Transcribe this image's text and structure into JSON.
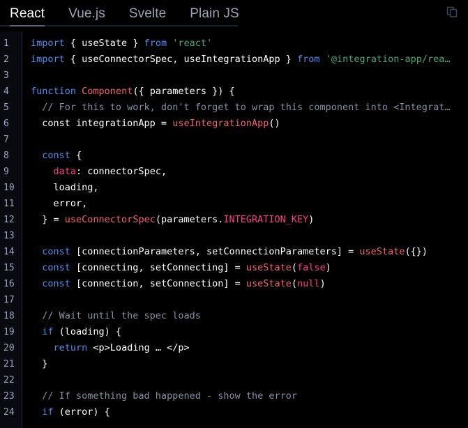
{
  "header": {
    "tabs": [
      {
        "label": "React",
        "active": true
      },
      {
        "label": "Vue.js",
        "active": false
      },
      {
        "label": "Svelte",
        "active": false
      },
      {
        "label": "Plain JS",
        "active": false
      }
    ],
    "copy_button": {
      "icon": "copy-icon",
      "title": "Copy"
    }
  },
  "editor": {
    "language": "jsx",
    "line_numbers": [
      "1",
      "2",
      "3",
      "4",
      "5",
      "6",
      "7",
      "8",
      "9",
      "10",
      "11",
      "12",
      "13",
      "14",
      "15",
      "16",
      "17",
      "18",
      "19",
      "20",
      "21",
      "22",
      "23",
      "24"
    ],
    "lines": [
      {
        "n": 1,
        "tokens": [
          {
            "t": "import",
            "c": "key"
          },
          {
            "t": " { useState } ",
            "c": "plain"
          },
          {
            "t": "from",
            "c": "key"
          },
          {
            "t": " ",
            "c": "plain"
          },
          {
            "t": "'react'",
            "c": "str"
          }
        ]
      },
      {
        "n": 2,
        "tokens": [
          {
            "t": "import",
            "c": "key"
          },
          {
            "t": " { useConnectorSpec, useIntegrationApp } ",
            "c": "plain"
          },
          {
            "t": "from",
            "c": "key"
          },
          {
            "t": " ",
            "c": "plain"
          },
          {
            "t": "'@integration-app/rea…",
            "c": "str"
          }
        ]
      },
      {
        "n": 3,
        "tokens": []
      },
      {
        "n": 4,
        "tokens": [
          {
            "t": "function",
            "c": "key"
          },
          {
            "t": " ",
            "c": "plain"
          },
          {
            "t": "Component",
            "c": "fn"
          },
          {
            "t": "({ parameters }) {",
            "c": "plain"
          }
        ]
      },
      {
        "n": 5,
        "tokens": [
          {
            "t": "  // For this to work, don't forget to wrap this component into <Integrat…",
            "c": "cmt"
          }
        ]
      },
      {
        "n": 6,
        "tokens": [
          {
            "t": "  const integrationApp = ",
            "c": "plain"
          },
          {
            "t": "useIntegrationApp",
            "c": "fn"
          },
          {
            "t": "()",
            "c": "plain"
          }
        ]
      },
      {
        "n": 7,
        "tokens": []
      },
      {
        "n": 8,
        "tokens": [
          {
            "t": "  ",
            "c": "plain"
          },
          {
            "t": "const",
            "c": "key"
          },
          {
            "t": " {",
            "c": "plain"
          }
        ]
      },
      {
        "n": 9,
        "tokens": [
          {
            "t": "    ",
            "c": "plain"
          },
          {
            "t": "data",
            "c": "const"
          },
          {
            "t": ": connectorSpec,",
            "c": "plain"
          }
        ]
      },
      {
        "n": 10,
        "tokens": [
          {
            "t": "    loading,",
            "c": "plain"
          }
        ]
      },
      {
        "n": 11,
        "tokens": [
          {
            "t": "    error,",
            "c": "plain"
          }
        ]
      },
      {
        "n": 12,
        "tokens": [
          {
            "t": "  } = ",
            "c": "plain"
          },
          {
            "t": "useConnectorSpec",
            "c": "fn"
          },
          {
            "t": "(parameters.",
            "c": "plain"
          },
          {
            "t": "INTEGRATION_KEY",
            "c": "const"
          },
          {
            "t": ")",
            "c": "plain"
          }
        ]
      },
      {
        "n": 13,
        "tokens": []
      },
      {
        "n": 14,
        "tokens": [
          {
            "t": "  ",
            "c": "plain"
          },
          {
            "t": "const",
            "c": "key"
          },
          {
            "t": " [connectionParameters, setConnectionParameters] = ",
            "c": "plain"
          },
          {
            "t": "useState",
            "c": "fn"
          },
          {
            "t": "({})",
            "c": "plain"
          }
        ]
      },
      {
        "n": 15,
        "tokens": [
          {
            "t": "  ",
            "c": "plain"
          },
          {
            "t": "const",
            "c": "key"
          },
          {
            "t": " [connecting, setConnecting] = ",
            "c": "plain"
          },
          {
            "t": "useState",
            "c": "fn"
          },
          {
            "t": "(",
            "c": "plain"
          },
          {
            "t": "false",
            "c": "const"
          },
          {
            "t": ")",
            "c": "plain"
          }
        ]
      },
      {
        "n": 16,
        "tokens": [
          {
            "t": "  ",
            "c": "plain"
          },
          {
            "t": "const",
            "c": "key"
          },
          {
            "t": " [connection, setConnection] = ",
            "c": "plain"
          },
          {
            "t": "useState",
            "c": "fn"
          },
          {
            "t": "(",
            "c": "plain"
          },
          {
            "t": "null",
            "c": "const"
          },
          {
            "t": ")",
            "c": "plain"
          }
        ]
      },
      {
        "n": 17,
        "tokens": []
      },
      {
        "n": 18,
        "tokens": [
          {
            "t": "  // Wait until the spec loads",
            "c": "cmt"
          }
        ]
      },
      {
        "n": 19,
        "tokens": [
          {
            "t": "  ",
            "c": "plain"
          },
          {
            "t": "if",
            "c": "key"
          },
          {
            "t": " (loading) {",
            "c": "plain"
          }
        ]
      },
      {
        "n": 20,
        "tokens": [
          {
            "t": "    ",
            "c": "plain"
          },
          {
            "t": "return",
            "c": "key"
          },
          {
            "t": " <p>Loading … </p>",
            "c": "plain"
          }
        ]
      },
      {
        "n": 21,
        "tokens": [
          {
            "t": "  }",
            "c": "plain"
          }
        ]
      },
      {
        "n": 22,
        "tokens": []
      },
      {
        "n": 23,
        "tokens": [
          {
            "t": "  // If something bad happened - show the error",
            "c": "cmt"
          }
        ]
      },
      {
        "n": 24,
        "tokens": [
          {
            "t": "  ",
            "c": "plain"
          },
          {
            "t": "if",
            "c": "key"
          },
          {
            "t": " (error) {",
            "c": "plain"
          }
        ]
      }
    ]
  },
  "theme": {
    "background": "#000000",
    "gutter_background": "#080a10",
    "gutter_text": "#9aa6bd",
    "gutter_divider": "#272c3b",
    "tab_inactive": "#9aa3b8",
    "tab_active": "#ffffff",
    "tab_indicator": "#5a6478",
    "tab_rule": "#1c2130",
    "keyword": "#4d8ff0",
    "function": "#f2636e",
    "string": "#49a97a",
    "comment": "#8790a3",
    "constant": "#ff3d8b",
    "plain": "#ffffff",
    "icon": "#3f4559"
  }
}
